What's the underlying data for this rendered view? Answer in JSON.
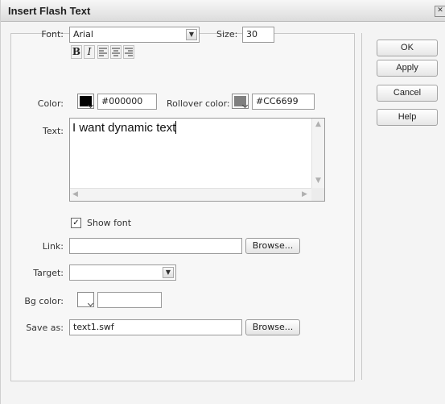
{
  "dialog": {
    "title": "Insert Flash Text",
    "close_glyph": "✕"
  },
  "font": {
    "label": "Font:",
    "value": "Arial",
    "arrow_icon": "chevron-down-icon"
  },
  "size": {
    "label": "Size:",
    "value": "30"
  },
  "format": {
    "bold": "B",
    "italic": "I"
  },
  "color": {
    "label": "Color:",
    "hex": "#000000",
    "swatch_color": "#000000"
  },
  "rollover": {
    "label": "Rollover color:",
    "hex": "#CC6699",
    "swatch_color": "#808080"
  },
  "text": {
    "label": "Text:",
    "value": "I want dynamic text"
  },
  "show_font": {
    "label": "Show font",
    "checked": true
  },
  "link": {
    "label": "Link:",
    "value": "",
    "browse_label": "Browse..."
  },
  "target": {
    "label": "Target:",
    "value": ""
  },
  "bg_color": {
    "label": "Bg color:",
    "hex": ""
  },
  "save_as": {
    "label": "Save as:",
    "value": "text1.swf",
    "browse_label": "Browse..."
  },
  "buttons": {
    "ok": "OK",
    "apply": "Apply",
    "cancel": "Cancel",
    "help": "Help"
  }
}
